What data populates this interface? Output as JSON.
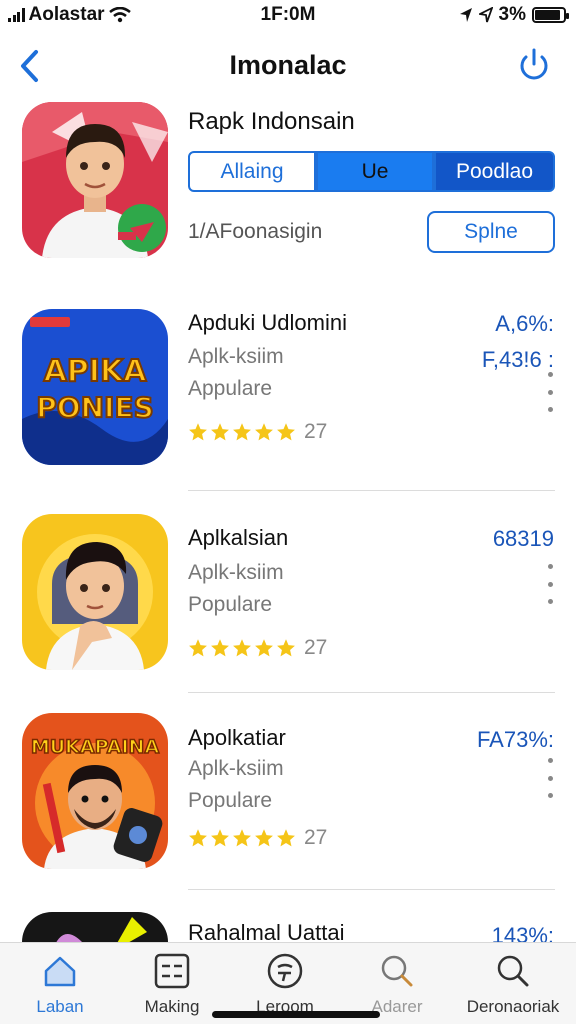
{
  "status": {
    "carrier": "Aolastar",
    "time": "1F:0M",
    "battery": "3%",
    "battery_level": 0.9
  },
  "nav": {
    "title": "Imonalac"
  },
  "featured": {
    "name": "Rapk Indonsain",
    "segments": [
      "Allaing",
      "Ue",
      "Poodlao"
    ],
    "subtitle": "1/AFoonasigin",
    "button": "Splne"
  },
  "apps": [
    {
      "name": "Apduki Udlomini",
      "line1": "Aplk-ksiim",
      "line2": "Appulare",
      "rating": 5,
      "count": "27",
      "value1": "A,6%:",
      "value2": "F,43!6 :",
      "icon_text": [
        "APIKA",
        "PONIES"
      ]
    },
    {
      "name": "Aplkalsian",
      "line1": "Aplk-ksiim",
      "line2": "Populare",
      "rating": 5,
      "count": "27",
      "value1": "68319"
    },
    {
      "name": "Apolkatiar",
      "line1": "Aplk-ksiim",
      "line2": "Populare",
      "rating": 5,
      "count": "27",
      "value1": "FA73%:",
      "icon_text": [
        "MUKAPAINA"
      ]
    },
    {
      "name": "Rahalmal Uattai",
      "value1": "143%:"
    }
  ],
  "tabs": [
    {
      "label": "Laban",
      "icon": "home-icon"
    },
    {
      "label": "Making",
      "icon": "grid-icon"
    },
    {
      "label": "Leroom",
      "icon": "clock-icon"
    },
    {
      "label": "Adarer",
      "icon": "search-icon"
    },
    {
      "label": "Deronaoriak",
      "icon": "search-icon"
    }
  ],
  "colors": {
    "accent": "#1e6fd9",
    "star": "#f5c518",
    "value": "#1a55b8"
  }
}
